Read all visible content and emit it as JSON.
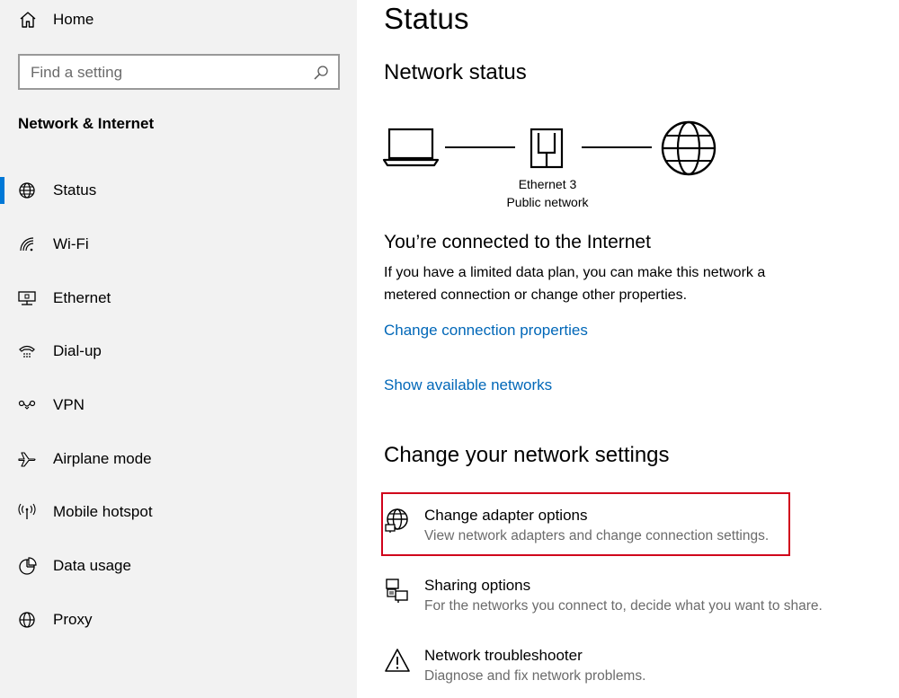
{
  "sidebar": {
    "home_label": "Home",
    "search": {
      "placeholder": "Find a setting",
      "value": ""
    },
    "section_title": "Network & Internet",
    "items": [
      {
        "label": "Status",
        "icon": "globe-status-icon",
        "selected": true
      },
      {
        "label": "Wi-Fi",
        "icon": "wifi-icon",
        "selected": false
      },
      {
        "label": "Ethernet",
        "icon": "ethernet-icon",
        "selected": false
      },
      {
        "label": "Dial-up",
        "icon": "dialup-icon",
        "selected": false
      },
      {
        "label": "VPN",
        "icon": "vpn-icon",
        "selected": false
      },
      {
        "label": "Airplane mode",
        "icon": "airplane-icon",
        "selected": false
      },
      {
        "label": "Mobile hotspot",
        "icon": "hotspot-icon",
        "selected": false
      },
      {
        "label": "Data usage",
        "icon": "data-usage-icon",
        "selected": false
      },
      {
        "label": "Proxy",
        "icon": "proxy-icon",
        "selected": false
      }
    ]
  },
  "main": {
    "title": "Status",
    "network_status_heading": "Network status",
    "diagram": {
      "adapter_name": "Ethernet 3",
      "network_type": "Public network"
    },
    "connected_heading": "You’re connected to the Internet",
    "connected_text": "If you have a limited data plan, you can make this network a metered connection or change other properties.",
    "links": {
      "change_properties": "Change connection properties",
      "show_networks": "Show available networks"
    },
    "change_settings_heading": "Change your network settings",
    "options": [
      {
        "title": "Change adapter options",
        "subtitle": "View network adapters and change connection settings.",
        "icon": "adapter-globe-icon"
      },
      {
        "title": "Sharing options",
        "subtitle": "For the networks you connect to, decide what you want to share.",
        "icon": "sharing-icon"
      },
      {
        "title": "Network troubleshooter",
        "subtitle": "Diagnose and fix network problems.",
        "icon": "warning-icon"
      }
    ]
  },
  "colors": {
    "accent": "#0078d7",
    "link": "#0067b8",
    "highlight_border": "#d0021b",
    "sidebar_bg": "#f2f2f2"
  }
}
